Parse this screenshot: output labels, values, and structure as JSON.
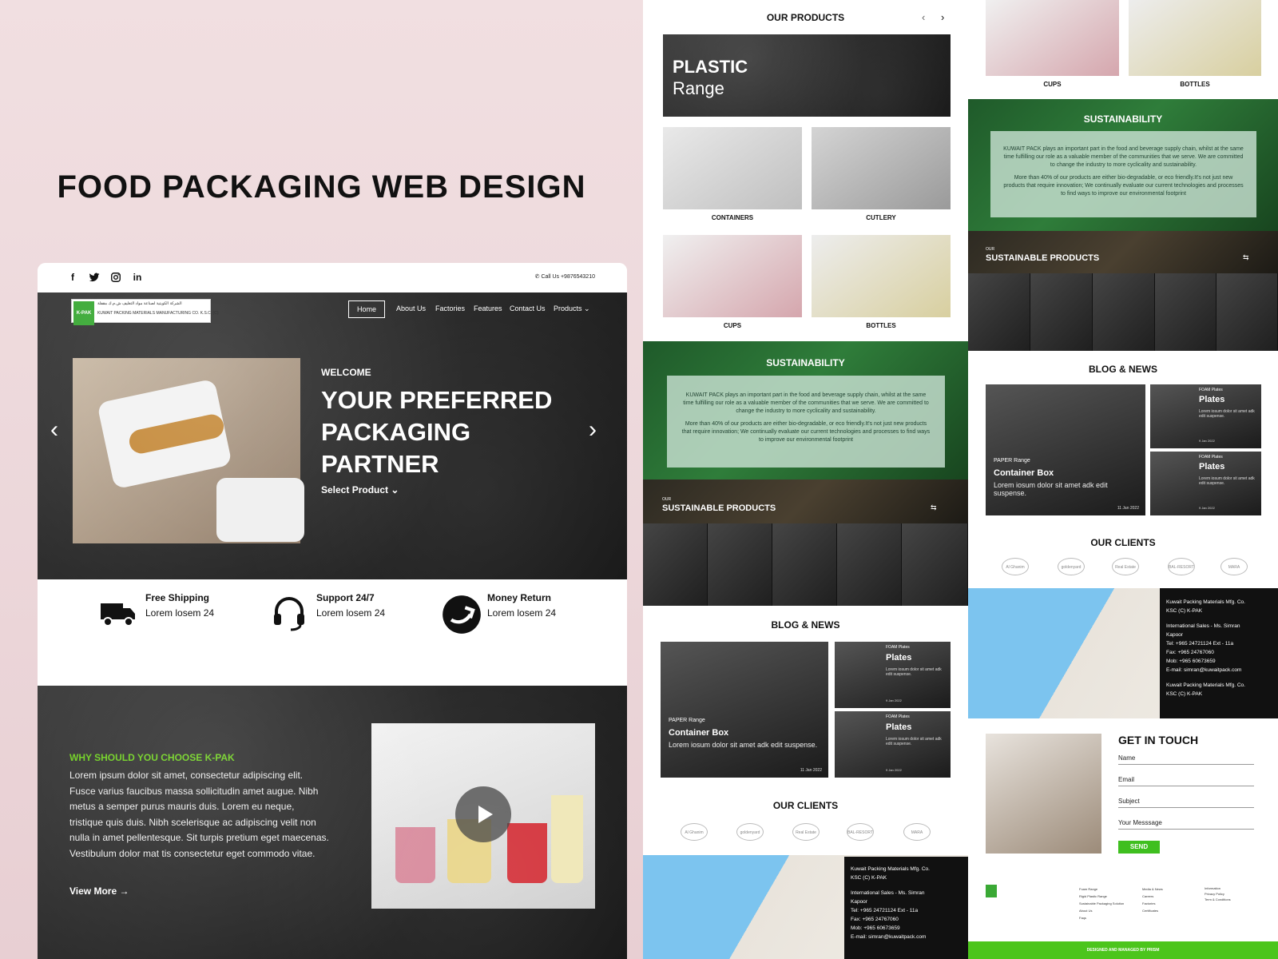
{
  "page_title": "FOOD PACKAGING WEB DESIGN",
  "topbar": {
    "call": "Call Us +9876543210",
    "social": [
      "f",
      "t",
      "ig",
      "in"
    ]
  },
  "logo": {
    "badge": "K-PAK",
    "arabic": "الشركة الكويتية لصناعة مواد التغليف ش.م.ك مقفلة",
    "english": "KUWAIT PACKING MATERIALS MANUFACTURING CO. K.S.C. (C)"
  },
  "nav": {
    "home": "Home",
    "about": "About Us",
    "factories": "Factories",
    "features": "Features",
    "contact": "Contact Us",
    "products": "Products"
  },
  "hero": {
    "welcome": "WELCOME",
    "line1": "YOUR PREFERRED",
    "line2": "PACKAGING",
    "line3": "PARTNER",
    "select": "Select Product"
  },
  "features": [
    {
      "title": "Free Shipping",
      "sub": "Lorem losem 24"
    },
    {
      "title": "Support 24/7",
      "sub": "Lorem losem 24"
    },
    {
      "title": "Money Return",
      "sub": "Lorem losem 24"
    }
  ],
  "why": {
    "title": "WHY SHOULD YOU CHOOSE K-PAK",
    "body": "Lorem ipsum dolor sit amet, consectetur adipiscing elit. Fusce varius faucibus massa sollicitudin amet augue. Nibh metus a semper purus mauris duis. Lorem eu neque, tristique quis duis. Nibh scelerisque ac adipiscing velit non nulla in amet pellentesque. Sit turpis pretium eget maecenas. Vestibulum dolor mat tis consectetur eget commodo vitae.",
    "view": "View More"
  },
  "products": {
    "title": "OUR PRODUCTS",
    "banner1": "PLASTIC",
    "banner2": "Range",
    "items": [
      "CONTAINERS",
      "CUTLERY",
      "CUPS",
      "BOTTLES"
    ]
  },
  "sustainability": {
    "title": "SUSTAINABILITY",
    "p1": "KUWAIT PACK plays an important part in the food and beverage supply chain, whilst at the same time fulfilling our role as a valuable member of the communities that we serve. We are committed to change the industry to more cyclicality and sustainability.",
    "p2": "More than 40% of our products are either bio-degradable, or eco friendly.It's not just new products that require innovation; We continually evaluate our current technologies and processes to find ways to improve our environmental footprint"
  },
  "sus_products": {
    "small": "OUR",
    "title": "SUSTAINABLE PRODUCTS"
  },
  "blog": {
    "title": "BLOG & NEWS",
    "main_tag": "PAPER Range",
    "main_title": "Container Box",
    "main_text": "Lorem iosum dolor sit amet adk edit suspense.",
    "main_date": "11 Jan 2022",
    "side_title": "Plates",
    "side_tag": "FOAM Plates",
    "side_text": "Lorem iosum dolor sit amet adk edit suspense.",
    "side_date": "9 Jan 2022"
  },
  "clients": {
    "title": "OUR CLIENTS",
    "names": [
      "Al Ghanim",
      "goldenyard",
      "Real Estate",
      "BAL-RESORT",
      "MARA"
    ]
  },
  "map_card": {
    "l1": "Kuwait Packing Materials Mfg. Co.",
    "l2": "KSC (C) K-PAK",
    "l3": "International Sales - Ms. Simran",
    "l4": "Kapoor",
    "l5": "Tel: +965 24721124 Ext - 11a",
    "l6": "Fax: +965 24767060",
    "l7": "Mob: +965 60673659",
    "l8": "E-mail: simran@kuwaitpack.com",
    "l9": "Kuwait Packing Materials Mfg. Co.",
    "l10": "KSC (C) K-PAK"
  },
  "contact": {
    "title": "GET IN TOUCH",
    "name": "Name",
    "email": "Email",
    "subject": "Subject",
    "message": "Your Messsage",
    "send": "SEND"
  },
  "footer": {
    "links1": [
      "Foam Range",
      "Rigid Plastic Range",
      "Sustainable Packaging Solution",
      "About Us",
      "Faqs"
    ],
    "links2": [
      "Media & News",
      "Careers",
      "Factories",
      "Certificates"
    ],
    "links3": [
      "Information",
      "Privacy Policy",
      "Term & Conditions"
    ],
    "credit": "DESIGNED AND MANAGED BY PRISM"
  }
}
